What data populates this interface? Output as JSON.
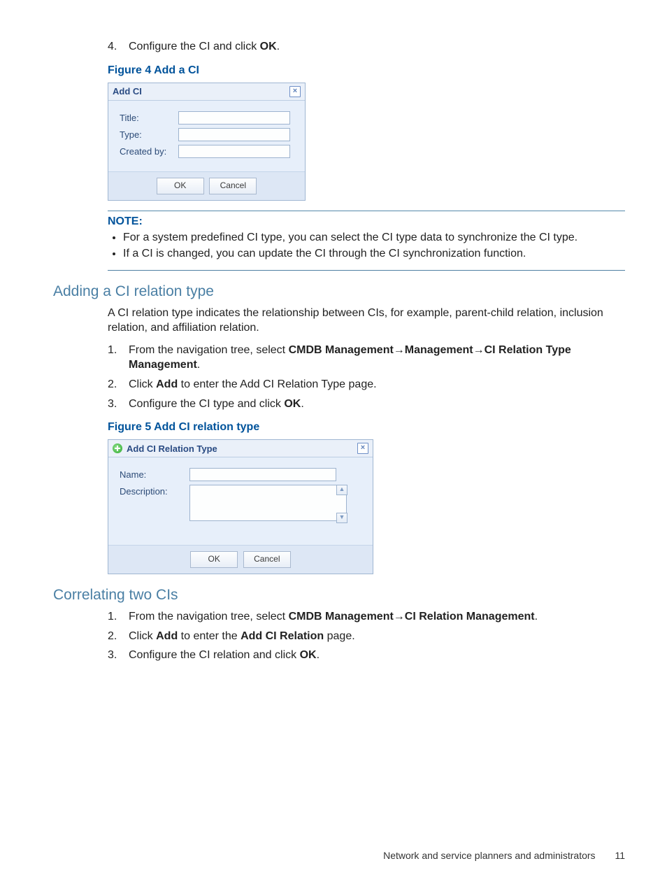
{
  "step4": {
    "n": "4.",
    "pre": "Configure the CI and click ",
    "bold": "OK",
    "post": "."
  },
  "fig4": {
    "caption": "Figure 4 Add a CI",
    "title": "Add CI",
    "fields": {
      "title_lbl": "Title:",
      "type_lbl": "Type:",
      "by_lbl": "Created by:"
    },
    "ok": "OK",
    "cancel": "Cancel"
  },
  "note": {
    "heading": "NOTE:",
    "b1": "For a system predefined CI type, you can select the CI type data to synchronize the CI type.",
    "b2": "If a CI is changed, you can update the CI through the CI synchronization function."
  },
  "sec_rel": {
    "heading": "Adding a CI relation type",
    "intro": "A CI relation type indicates the relationship between CIs, for example, parent-child relation, inclusion relation, and affiliation relation.",
    "s1": {
      "n": "1.",
      "pre": "From the navigation tree, select ",
      "b1": "CMDB Management",
      "arrow1": "→",
      "b2": "Management",
      "arrow2": "→",
      "b3": "CI Relation Type Management",
      "post": "."
    },
    "s2": {
      "n": "2.",
      "pre": "Click ",
      "b": "Add",
      "post": " to enter the Add CI Relation Type page."
    },
    "s3": {
      "n": "3.",
      "pre": "Configure the CI type and click ",
      "b": "OK",
      "post": "."
    }
  },
  "fig5": {
    "caption": "Figure 5 Add CI relation type",
    "title": "Add CI Relation Type",
    "name_lbl": "Name:",
    "desc_lbl": "Description:",
    "ok": "OK",
    "cancel": "Cancel"
  },
  "sec_corr": {
    "heading": "Correlating two CIs",
    "s1": {
      "n": "1.",
      "pre": "From the navigation tree, select ",
      "b1": "CMDB Management",
      "arrow": "→",
      "b2": "CI Relation Management",
      "post": "."
    },
    "s2": {
      "n": "2.",
      "pre": "Click ",
      "b1": "Add",
      "mid": " to enter the ",
      "b2": "Add CI Relation",
      "post": " page."
    },
    "s3": {
      "n": "3.",
      "pre": "Configure the CI relation and click ",
      "b": "OK",
      "post": "."
    }
  },
  "footer": {
    "text": "Network and service planners and administrators",
    "page": "11"
  }
}
